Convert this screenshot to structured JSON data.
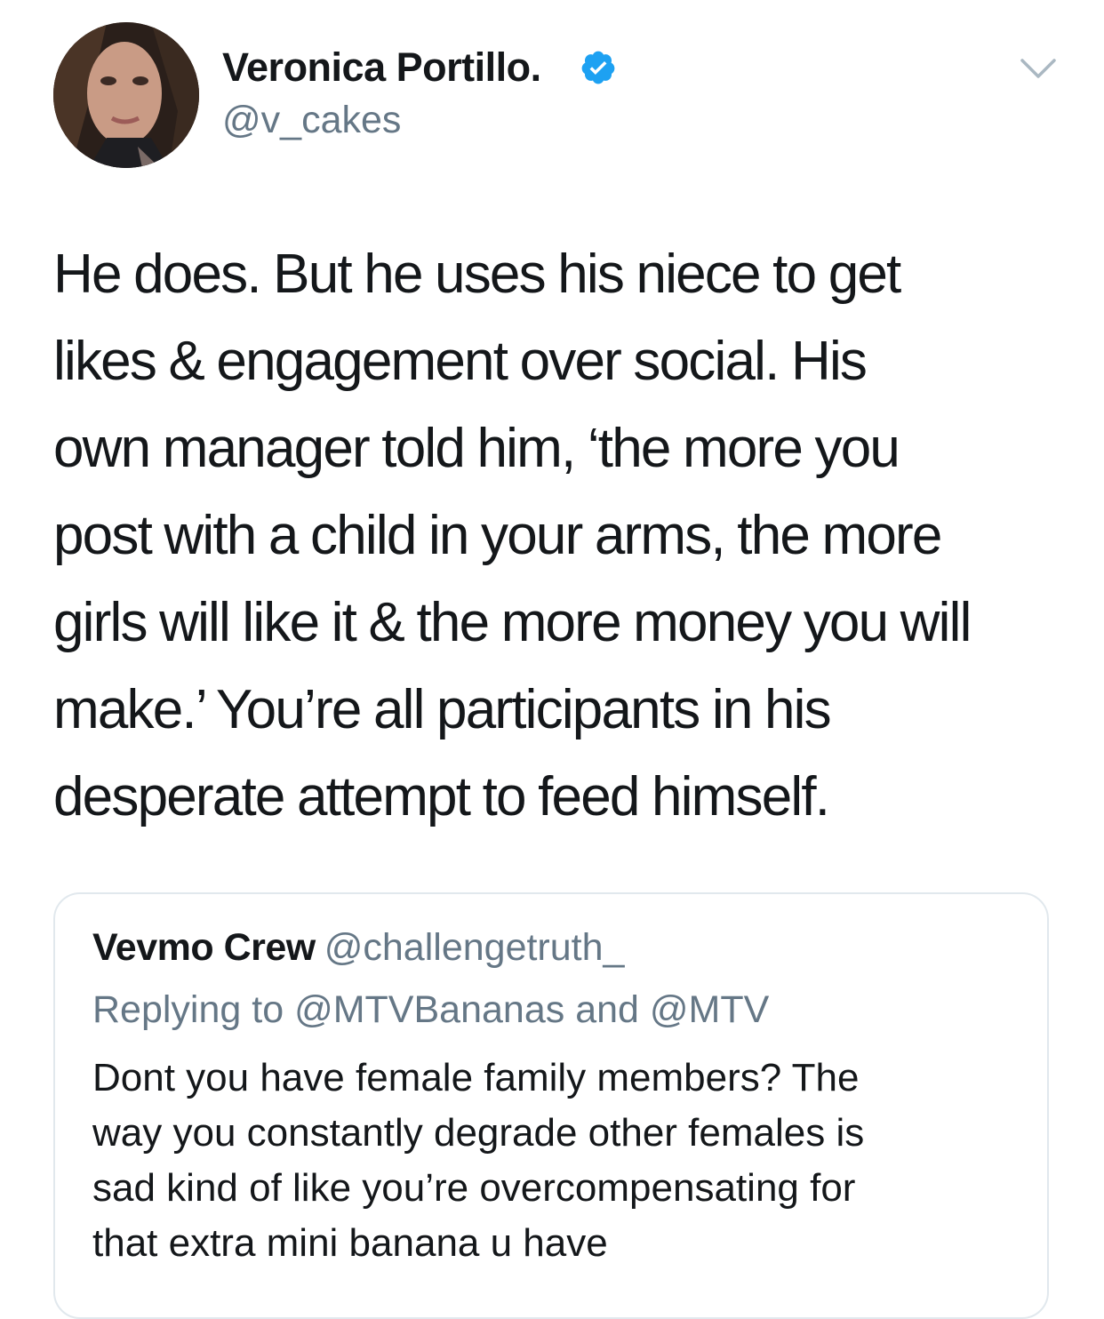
{
  "author": {
    "display_name": "Veronica Portillo.",
    "handle": "@v_cakes",
    "verified": true,
    "verified_icon": "verified-badge-icon",
    "verified_color": "#1da1f2"
  },
  "tweet": {
    "lines": [
      "He does.  But he uses his niece to get",
      "likes & engagement over social.  His",
      "own manager told him, ‘the more you",
      "post with a child in your arms, the more",
      "girls will like it & the more money you will",
      "make.’ You’re all participants in his",
      "desperate attempt to feed himself."
    ]
  },
  "menu": {
    "icon": "chevron-down-icon"
  },
  "quoted_tweet": {
    "display_name": "Vevmo Crew",
    "handle": "@challengetruth_",
    "replying_to": "Replying to @MTVBananas and @MTV",
    "lines": [
      "Dont you have female family members? The",
      "way you constantly degrade other females is",
      "sad kind of like you’re overcompensating for",
      "that extra mini banana u have"
    ]
  },
  "colors": {
    "text_primary": "#14171a",
    "text_secondary": "#657786",
    "border": "#e1e8ed",
    "accent": "#1da1f2"
  }
}
